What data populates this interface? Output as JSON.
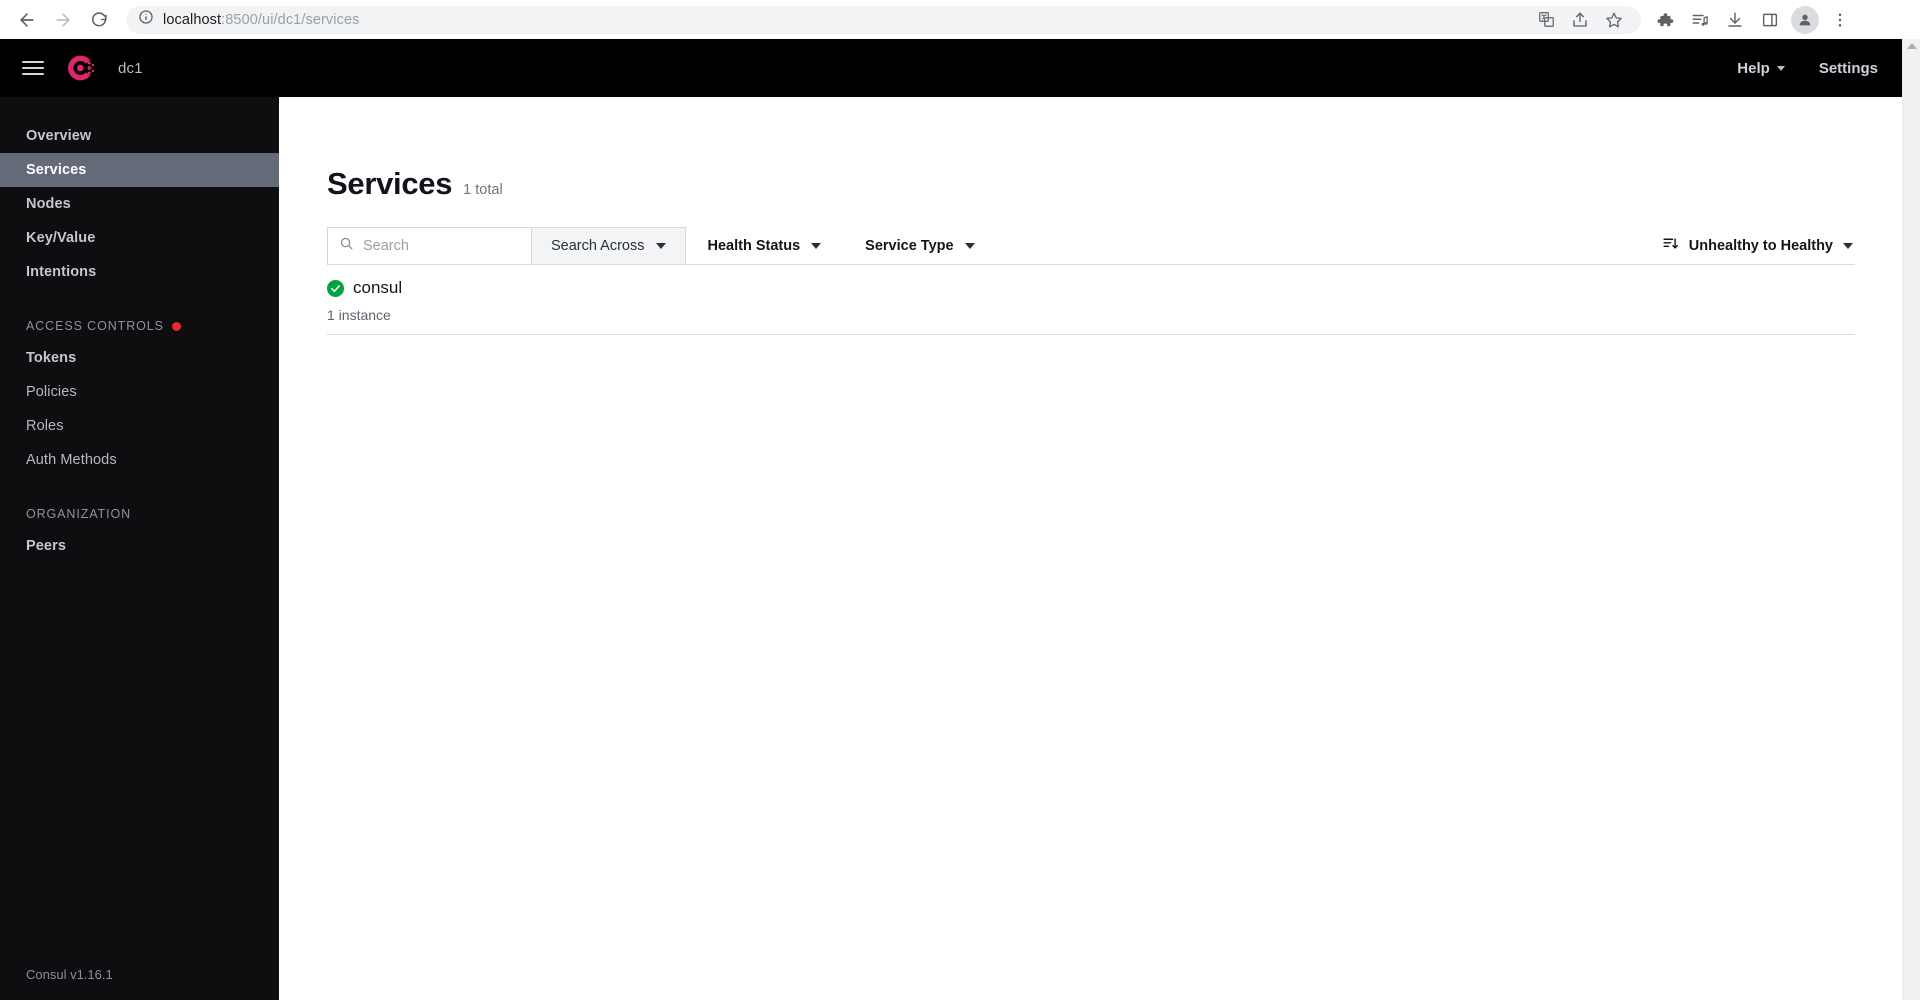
{
  "browser": {
    "url_host": "localhost",
    "url_path": ":8500/ui/dc1/services",
    "back_icon": "back-arrow-icon",
    "forward_icon": "forward-arrow-icon",
    "reload_icon": "reload-icon",
    "info_icon": "site-info-icon",
    "translate_icon": "translate-icon",
    "share_icon": "share-icon",
    "bookmark_icon": "star-bookmark-icon",
    "extensions_icon": "puzzle-extensions-icon",
    "media_icon": "media-playlist-icon",
    "downloads_icon": "download-icon",
    "sidepanel_icon": "side-panel-icon",
    "profile_icon": "profile-avatar-icon",
    "menu_icon": "three-dot-menu-icon"
  },
  "topnav": {
    "menu_icon": "hamburger-menu-icon",
    "logo_icon": "consul-logo-icon",
    "datacenter": "dc1",
    "help_label": "Help",
    "settings_label": "Settings"
  },
  "sidebar": {
    "items": [
      {
        "label": "Overview",
        "active": false,
        "bold": true
      },
      {
        "label": "Services",
        "active": true,
        "bold": true
      },
      {
        "label": "Nodes",
        "active": false,
        "bold": true
      },
      {
        "label": "Key/Value",
        "active": false,
        "bold": true
      },
      {
        "label": "Intentions",
        "active": false,
        "bold": true
      }
    ],
    "sections": [
      {
        "title": "ACCESS CONTROLS",
        "badge": true,
        "items": [
          {
            "label": "Tokens",
            "bold": true
          },
          {
            "label": "Policies",
            "bold": false
          },
          {
            "label": "Roles",
            "bold": false
          },
          {
            "label": "Auth Methods",
            "bold": false
          }
        ]
      },
      {
        "title": "ORGANIZATION",
        "badge": false,
        "items": [
          {
            "label": "Peers",
            "bold": true
          }
        ]
      }
    ],
    "version": "Consul v1.16.1"
  },
  "page": {
    "title": "Services",
    "count_label": "1 total"
  },
  "filters": {
    "search_placeholder": "Search",
    "search_value": "",
    "search_icon": "search-magnifier-icon",
    "search_across_label": "Search Across",
    "health_status_label": "Health Status",
    "service_type_label": "Service Type",
    "sort_icon": "sort-descending-icon",
    "sort_label": "Unhealthy to Healthy"
  },
  "services": [
    {
      "name": "consul",
      "instances": "1 instance",
      "health": "passing",
      "health_icon": "check-circle-icon"
    }
  ],
  "colors": {
    "accent": "#e0246b",
    "health_pass": "#00a441",
    "sidebar_bg": "#0e0e10",
    "sidebar_active": "#656a78",
    "alert_dot": "#e8292b"
  }
}
